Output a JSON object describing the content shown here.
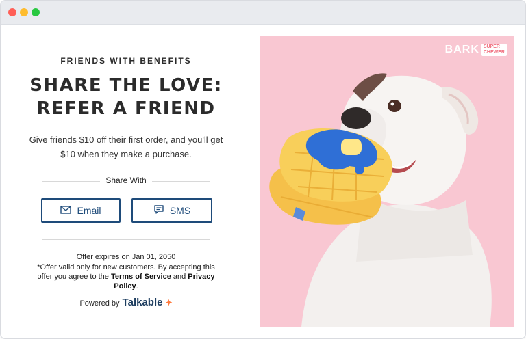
{
  "window": {
    "controls": [
      "close",
      "minimize",
      "maximize"
    ]
  },
  "promo": {
    "eyebrow": "FRIENDS WITH BENEFITS",
    "headline_line1": "SHARE THE LOVE:",
    "headline_line2": "REFER A FRIEND",
    "description": "Give friends $10 off their first order, and you'll get $10 when they make a purchase.",
    "share_label": "Share With",
    "buttons": {
      "email": "Email",
      "sms": "SMS"
    },
    "expiry": "Offer expires on Jan 01, 2050",
    "terms_prefix": "*Offer valid only for new customers. By accepting this offer you agree to the ",
    "terms_link": "Terms of Service",
    "terms_and": " and ",
    "privacy_link": "Privacy Policy",
    "terms_end": ".",
    "powered_by": "Powered by",
    "powered_brand": "Talkable"
  },
  "hero": {
    "logo_main": "BARK",
    "logo_sub_line1": "SUPER",
    "logo_sub_line2": "CHEWER",
    "image": "white-dog-with-waffle-toy",
    "background_color": "#f9c7d2"
  },
  "colors": {
    "accent": "#1e4b7a",
    "text": "#2b2b2b",
    "talkable_mark": "#ff7a3d"
  }
}
